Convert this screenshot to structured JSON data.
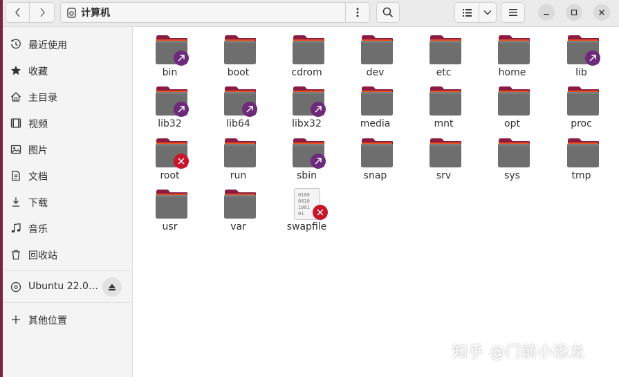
{
  "window": {
    "location_title": "计算机",
    "colors": {
      "accent": "#e95420",
      "folder_body": "#6e6e6e",
      "folder_tab": "#8b1b42",
      "link_badge": "#6d2a7a",
      "error_badge": "#c7162b"
    }
  },
  "header": {
    "back_icon": "chevron-left-icon",
    "forward_icon": "chevron-right-icon",
    "path_icon": "computer-icon",
    "path_menu_icon": "vertical-ellipsis-icon",
    "search_icon": "search-icon",
    "view_icon": "list-view-icon",
    "view_menu_icon": "chevron-down-icon",
    "main_menu_icon": "hamburger-icon"
  },
  "sidebar": {
    "items": [
      {
        "label": "最近使用",
        "icon": "clock-icon"
      },
      {
        "label": "收藏",
        "icon": "star-icon"
      },
      {
        "label": "主目录",
        "icon": "home-icon"
      },
      {
        "label": "视频",
        "icon": "film-icon"
      },
      {
        "label": "图片",
        "icon": "image-icon"
      },
      {
        "label": "文档",
        "icon": "document-icon"
      },
      {
        "label": "下载",
        "icon": "download-icon"
      },
      {
        "label": "音乐",
        "icon": "music-icon"
      },
      {
        "label": "回收站",
        "icon": "trash-icon"
      }
    ],
    "device": {
      "label": "Ubuntu 22.0…",
      "icon": "disc-icon",
      "eject_icon": "eject-icon"
    },
    "other": {
      "label": "其他位置",
      "icon": "plus-icon"
    }
  },
  "files": [
    {
      "name": "bin",
      "type": "folder",
      "badge": "link"
    },
    {
      "name": "boot",
      "type": "folder",
      "badge": ""
    },
    {
      "name": "cdrom",
      "type": "folder",
      "badge": ""
    },
    {
      "name": "dev",
      "type": "folder",
      "badge": ""
    },
    {
      "name": "etc",
      "type": "folder",
      "badge": ""
    },
    {
      "name": "home",
      "type": "folder",
      "badge": ""
    },
    {
      "name": "lib",
      "type": "folder",
      "badge": "link"
    },
    {
      "name": "lib32",
      "type": "folder",
      "badge": "link"
    },
    {
      "name": "lib64",
      "type": "folder",
      "badge": "link"
    },
    {
      "name": "libx32",
      "type": "folder",
      "badge": "link"
    },
    {
      "name": "media",
      "type": "folder",
      "badge": ""
    },
    {
      "name": "mnt",
      "type": "folder",
      "badge": ""
    },
    {
      "name": "opt",
      "type": "folder",
      "badge": ""
    },
    {
      "name": "proc",
      "type": "folder",
      "badge": ""
    },
    {
      "name": "root",
      "type": "folder",
      "badge": "error"
    },
    {
      "name": "run",
      "type": "folder",
      "badge": ""
    },
    {
      "name": "sbin",
      "type": "folder",
      "badge": "link"
    },
    {
      "name": "snap",
      "type": "folder",
      "badge": ""
    },
    {
      "name": "srv",
      "type": "folder",
      "badge": ""
    },
    {
      "name": "sys",
      "type": "folder",
      "badge": ""
    },
    {
      "name": "tmp",
      "type": "folder",
      "badge": ""
    },
    {
      "name": "usr",
      "type": "folder",
      "badge": ""
    },
    {
      "name": "var",
      "type": "folder",
      "badge": ""
    },
    {
      "name": "swapfile",
      "type": "binary",
      "badge": "error",
      "preview": "0100\n0010\n1001\n01"
    }
  ],
  "watermark": "知乎 @门前小恐龙"
}
